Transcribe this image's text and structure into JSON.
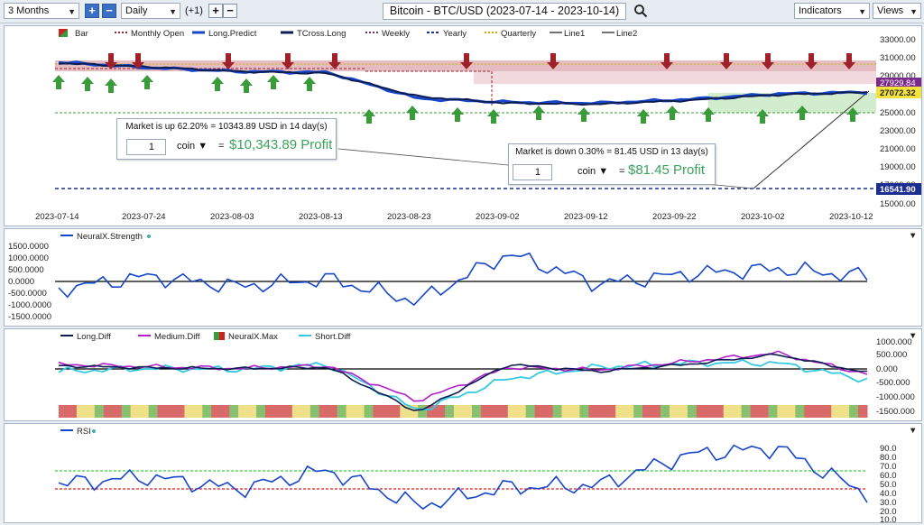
{
  "toolbar": {
    "range": "3 Months",
    "interval": "Daily",
    "step": "(+1)",
    "plus": "+",
    "minus": "−",
    "title": "Bitcoin - BTC/USD (2023-07-14 - 2023-10-14)",
    "indicators": "Indicators",
    "views": "Views"
  },
  "price_panel": {
    "legend": [
      "Bar",
      "Monthly Open",
      "Long.Predict",
      "TCross.Long",
      "Weekly",
      "Yearly",
      "Quarterly",
      "Line1",
      "Line2"
    ],
    "y_ticks": [
      "33000.00",
      "31000.00",
      "29000.00",
      "25000.00",
      "23000.00",
      "21000.00",
      "19000.00",
      "17000.00",
      "15000.00"
    ],
    "x_ticks": [
      "2023-07-14",
      "2023-07-24",
      "2023-08-03",
      "2023-08-13",
      "2023-08-23",
      "2023-09-02",
      "2023-09-12",
      "2023-09-22",
      "2023-10-02",
      "2023-10-12"
    ],
    "tag_upper": "27929.84",
    "tag_current": "27072.32",
    "tag_low": "16541.90",
    "box1": {
      "text": "Market is up 62.20% = 10343.89 USD in 14 day(s)",
      "qty": "1",
      "unit": "coin",
      "eq": "=",
      "profit": "$10,343.89 Profit"
    },
    "box2": {
      "text": "Market is down 0.30% = 81.45 USD in 13 day(s)",
      "qty": "1",
      "unit": "coin",
      "eq": "=",
      "profit": "$81.45 Profit"
    }
  },
  "strength_panel": {
    "legend": "NeuralX.Strength",
    "y_ticks": [
      "1500.0000",
      "1000.0000",
      "500.0000",
      "0.0000",
      "-500.0000",
      "-1000.0000",
      "-1500.0000"
    ]
  },
  "diff_panel": {
    "legend": [
      "Long.Diff",
      "Medium.Diff",
      "NeuralX.Max",
      "Short.Diff"
    ],
    "y_ticks": [
      "1000.000",
      "500.000",
      "0.000",
      "-500.000",
      "-1000.000",
      "-1500.000"
    ]
  },
  "rsi_panel": {
    "legend": "RSI",
    "y_ticks": [
      "90.0",
      "80.0",
      "70.0",
      "60.0",
      "50.0",
      "40.0",
      "30.0",
      "20.0",
      "10.0"
    ]
  },
  "colors": {
    "up": "#3a9b3a",
    "down": "#a0202a",
    "line_blue": "#1746c9",
    "navy": "#0d1d52",
    "magenta": "#b020c8",
    "cyan": "#36c8e0",
    "tag_current": "#f5e23a",
    "tag_upper": "#7a2a8a",
    "tag_low": "#1c2e90"
  },
  "chart_data": [
    {
      "type": "line",
      "title": "Bitcoin - BTC/USD (2023-07-14 - 2023-10-14)",
      "x": [
        "2023-07-14",
        "2023-07-24",
        "2023-08-03",
        "2023-08-13",
        "2023-08-23",
        "2023-09-02",
        "2023-09-12",
        "2023-09-22",
        "2023-10-02",
        "2023-10-12"
      ],
      "series": [
        {
          "name": "Long.Predict",
          "values": [
            30300,
            29700,
            29300,
            29200,
            26400,
            26000,
            25900,
            26300,
            26900,
            27072
          ]
        },
        {
          "name": "TCross.Long",
          "values": [
            30200,
            29800,
            29300,
            29100,
            26600,
            25900,
            25800,
            26200,
            26800,
            27072
          ]
        }
      ],
      "ylim": [
        15000,
        33000
      ]
    },
    {
      "type": "line",
      "x": [
        "2023-07-14",
        "2023-07-24",
        "2023-08-03",
        "2023-08-13",
        "2023-08-23",
        "2023-09-02",
        "2023-09-12",
        "2023-09-22",
        "2023-10-02",
        "2023-10-12"
      ],
      "series": [
        {
          "name": "NeuralX.Strength",
          "values": [
            -300,
            200,
            -200,
            100,
            -800,
            1100,
            -100,
            300,
            500,
            200
          ]
        }
      ],
      "ylim": [
        -1500,
        1500
      ]
    },
    {
      "type": "line",
      "x": [
        "2023-07-14",
        "2023-07-24",
        "2023-08-03",
        "2023-08-13",
        "2023-08-23",
        "2023-09-02",
        "2023-09-12",
        "2023-09-22",
        "2023-10-02",
        "2023-10-12"
      ],
      "series": [
        {
          "name": "Long.Diff",
          "values": [
            150,
            80,
            50,
            100,
            -1500,
            200,
            -50,
            200,
            550,
            -100
          ]
        },
        {
          "name": "Medium.Diff",
          "values": [
            200,
            120,
            60,
            150,
            -1100,
            100,
            0,
            300,
            600,
            -150
          ]
        },
        {
          "name": "Short.Diff",
          "values": [
            -50,
            60,
            20,
            200,
            -1450,
            -300,
            100,
            250,
            250,
            -350
          ]
        }
      ],
      "ylim": [
        -1500,
        1000
      ]
    },
    {
      "type": "line",
      "x": [
        "2023-07-14",
        "2023-07-24",
        "2023-08-03",
        "2023-08-13",
        "2023-08-23",
        "2023-09-02",
        "2023-09-12",
        "2023-09-22",
        "2023-10-02",
        "2023-10-12"
      ],
      "series": [
        {
          "name": "RSI",
          "values": [
            44,
            52,
            38,
            60,
            18,
            40,
            42,
            78,
            86,
            32
          ]
        }
      ],
      "ylim": [
        0,
        95
      ]
    }
  ]
}
